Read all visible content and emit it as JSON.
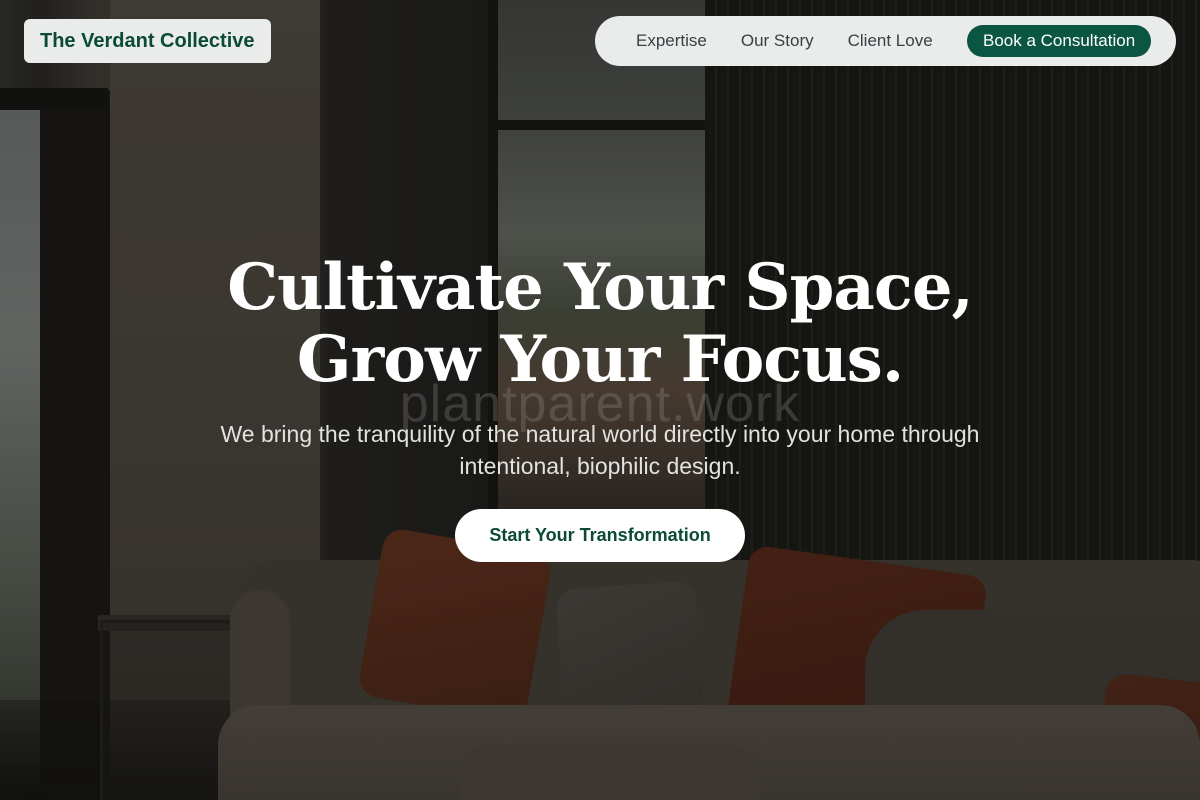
{
  "brand": {
    "name": "The Verdant Collective",
    "color": "#0b4a36"
  },
  "nav": {
    "links": [
      "Expertise",
      "Our Story",
      "Client Love"
    ],
    "cta": "Book a Consultation",
    "cta_color": "#0b5543"
  },
  "hero": {
    "title_line_1": "Cultivate Your Space,",
    "title_line_2": "Grow Your Focus.",
    "watermark": "plantparent.work",
    "subtitle": "We bring the tranquility of the natural world directly into your home through intentional, biophilic design.",
    "cta": "Start Your Transformation"
  }
}
